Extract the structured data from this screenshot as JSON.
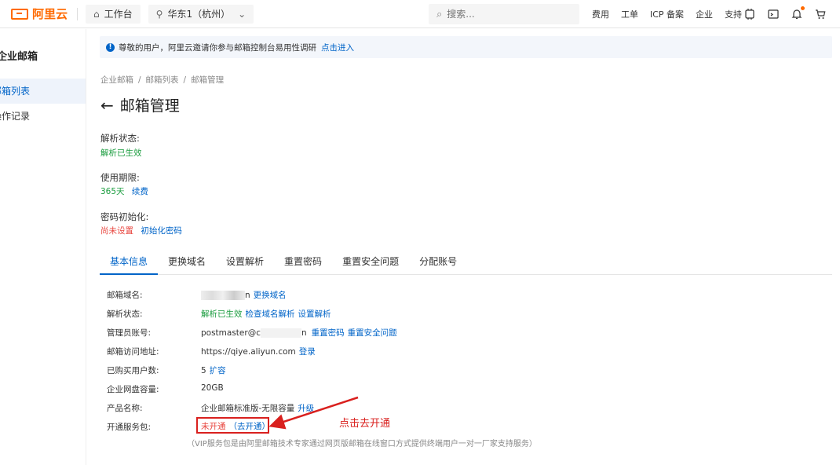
{
  "topbar": {
    "logo_text": "阿里云",
    "workbench": "工作台",
    "region": "华东1（杭州）",
    "search_placeholder": "搜索...",
    "links": [
      "费用",
      "工单",
      "ICP 备案",
      "企业",
      "支持"
    ]
  },
  "sidebar": {
    "title": "企业邮箱",
    "items": [
      "邮箱列表",
      "操作记录"
    ]
  },
  "notice": {
    "text": "尊敬的用户，阿里云邀请你参与邮箱控制台易用性调研",
    "link": "点击进入"
  },
  "breadcrumb": [
    "企业邮箱",
    "邮箱列表",
    "邮箱管理"
  ],
  "page_title": "邮箱管理",
  "status_fields": [
    {
      "label": "解析状态:",
      "value": "解析已生效",
      "action": ""
    },
    {
      "label": "使用期限:",
      "value": "365天",
      "action": "续费"
    },
    {
      "label": "密码初始化:",
      "value": "尚未设置",
      "action": "初始化密码"
    }
  ],
  "tabs": [
    "基本信息",
    "更换域名",
    "设置解析",
    "重置密码",
    "重置安全问题",
    "分配账号"
  ],
  "details": [
    {
      "label": "邮箱域名:",
      "value": "n",
      "links": [
        "更换域名"
      ]
    },
    {
      "label": "解析状态:",
      "value": "解析已生效",
      "links": [
        "检查域名解析",
        "设置解析"
      ]
    },
    {
      "label": "管理员账号:",
      "value": "postmaster@c",
      "value_tail": "n",
      "links": [
        "重置密码",
        "重置安全问题"
      ]
    },
    {
      "label": "邮箱访问地址:",
      "value": "https://qiye.aliyun.com",
      "links": [
        "登录"
      ]
    },
    {
      "label": "已购买用户数:",
      "value": "5",
      "links": [
        "扩容"
      ]
    },
    {
      "label": "企业网盘容量:",
      "value": "20GB",
      "links": []
    },
    {
      "label": "产品名称:",
      "value": "企业邮箱标准版-无限容量",
      "links": [
        "升级"
      ]
    }
  ],
  "service": {
    "label": "开通服务包:",
    "status": "未开通",
    "action": "（去开通）",
    "note": "（VIP服务包是由阿里邮箱技术专家通过网页版邮箱在线窗口方式提供终端用户一对一厂家支持服务）"
  },
  "annotation": "点击去开通",
  "colors": {
    "brand": "#ff6a00",
    "link": "#0064c8",
    "success": "#1a9c3e",
    "danger": "#e8463f",
    "annotation": "#d9201e"
  }
}
